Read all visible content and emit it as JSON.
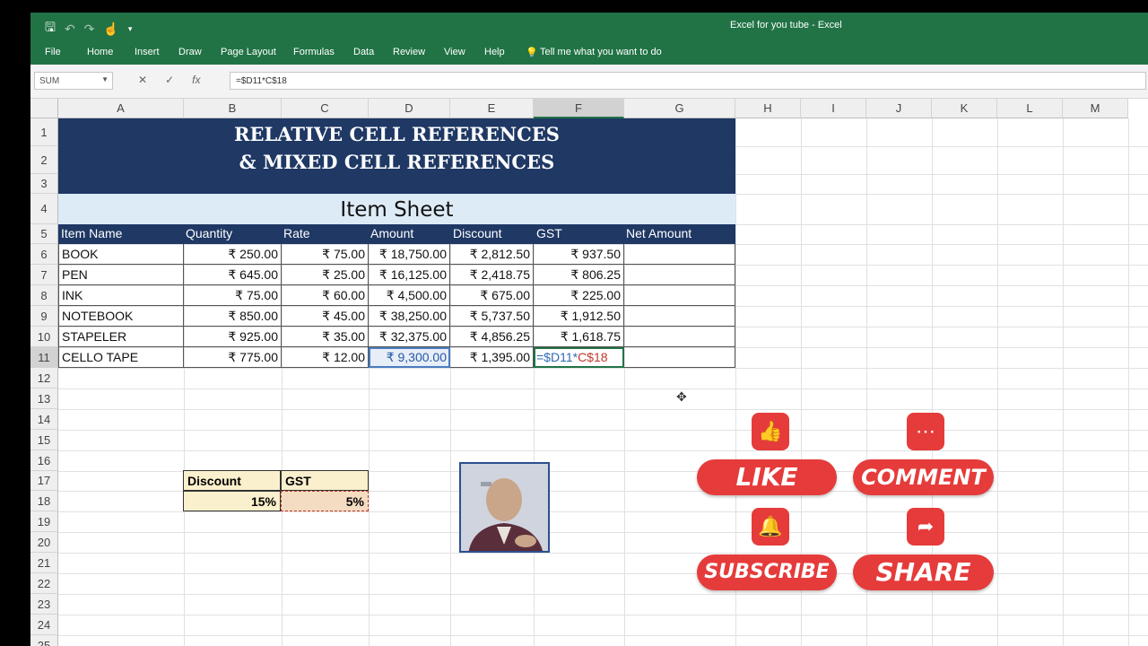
{
  "window": {
    "title": "Excel for you tube  -  Excel"
  },
  "ribbon": {
    "tabs": [
      "File",
      "Home",
      "Insert",
      "Draw",
      "Page Layout",
      "Formulas",
      "Data",
      "Review",
      "View",
      "Help"
    ],
    "tell_me": "Tell me what you want to do"
  },
  "formula_bar": {
    "name_box": "SUM",
    "formula": "=$D11*C$18"
  },
  "columns": [
    "A",
    "B",
    "C",
    "D",
    "E",
    "F",
    "G",
    "H",
    "I",
    "J",
    "K",
    "L",
    "M"
  ],
  "rows": [
    "1",
    "2",
    "3",
    "4",
    "5",
    "6",
    "7",
    "8",
    "9",
    "10",
    "11",
    "12",
    "13",
    "14",
    "15",
    "16",
    "17",
    "18",
    "19",
    "20",
    "21",
    "22",
    "23",
    "24",
    "25"
  ],
  "banner": {
    "line1": "RELATIVE CELL REFERENCES",
    "line2": "& MIXED CELL REFERENCES"
  },
  "subtitle": "Item Sheet",
  "table": {
    "headers": [
      "Item Name",
      "Quantity",
      "Rate",
      "Amount",
      "Discount",
      "GST",
      "Net Amount"
    ],
    "rows": [
      [
        "BOOK",
        "₹ 250.00",
        "₹ 75.00",
        "₹ 18,750.00",
        "₹ 2,812.50",
        "₹ 937.50",
        ""
      ],
      [
        "PEN",
        "₹ 645.00",
        "₹ 25.00",
        "₹ 16,125.00",
        "₹ 2,418.75",
        "₹ 806.25",
        ""
      ],
      [
        "INK",
        "₹ 75.00",
        "₹ 60.00",
        "₹ 4,500.00",
        "₹ 675.00",
        "₹ 225.00",
        ""
      ],
      [
        "NOTEBOOK",
        "₹ 850.00",
        "₹ 45.00",
        "₹ 38,250.00",
        "₹ 5,737.50",
        "₹ 1,912.50",
        ""
      ],
      [
        "STAPELER",
        "₹ 925.00",
        "₹ 35.00",
        "₹ 32,375.00",
        "₹ 4,856.25",
        "₹ 1,618.75",
        ""
      ],
      [
        "CELLO TAPE",
        "₹ 775.00",
        "₹ 12.00",
        "₹ 9,300.00",
        "₹ 1,395.00",
        "",
        ""
      ]
    ],
    "editing_formula_part1": "=$D11*",
    "editing_formula_part2": "C$18"
  },
  "rates": {
    "discount_label": "Discount",
    "gst_label": "GST",
    "discount_value": "15%",
    "gst_value": "5%"
  },
  "social": {
    "like": "LIKE",
    "comment": "COMMENT",
    "subscribe": "SUBSCRIBE",
    "share": "SHARE"
  },
  "colors": {
    "excel_green": "#217346",
    "banner_navy": "#1f3864",
    "subtitle_blue": "#ddebf7",
    "social_red": "#e63b3b",
    "rate_fill": "#fbf0cd"
  }
}
